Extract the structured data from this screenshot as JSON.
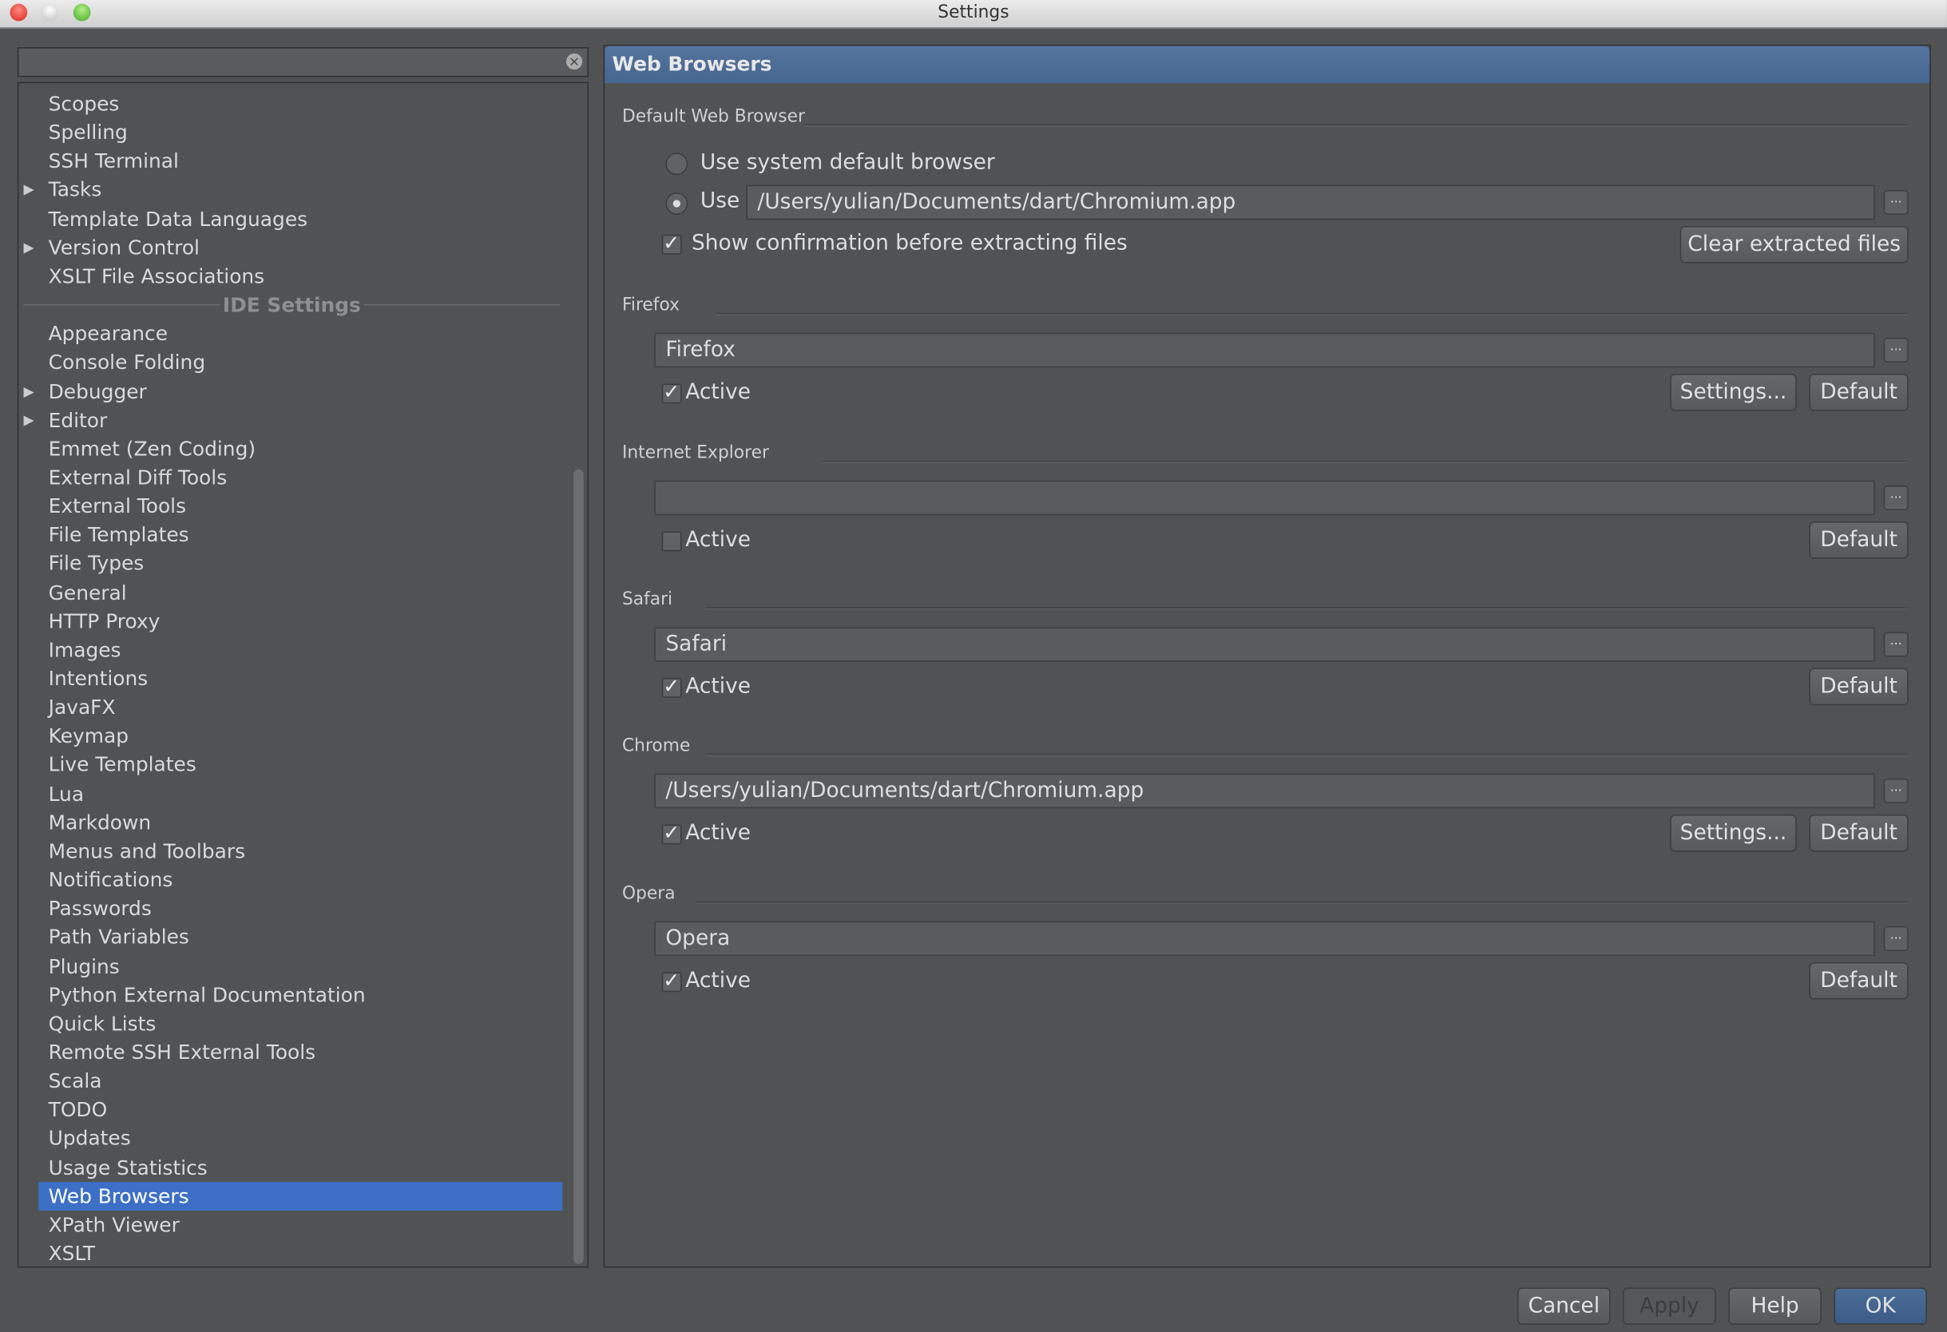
{
  "window": {
    "title": "Settings"
  },
  "search": {
    "value": ""
  },
  "tree": {
    "items": [
      {
        "label": "Scopes"
      },
      {
        "label": "Spelling"
      },
      {
        "label": "SSH Terminal"
      },
      {
        "label": "Tasks",
        "expandable": true
      },
      {
        "label": "Template Data Languages"
      },
      {
        "label": "Version Control",
        "expandable": true
      },
      {
        "label": "XSLT File Associations"
      },
      {
        "label": "IDE Settings",
        "header": true
      },
      {
        "label": "Appearance"
      },
      {
        "label": "Console Folding"
      },
      {
        "label": "Debugger",
        "expandable": true
      },
      {
        "label": "Editor",
        "expandable": true
      },
      {
        "label": "Emmet (Zen Coding)"
      },
      {
        "label": "External Diff Tools"
      },
      {
        "label": "External Tools"
      },
      {
        "label": "File Templates"
      },
      {
        "label": "File Types"
      },
      {
        "label": "General"
      },
      {
        "label": "HTTP Proxy"
      },
      {
        "label": "Images"
      },
      {
        "label": "Intentions"
      },
      {
        "label": "JavaFX"
      },
      {
        "label": "Keymap"
      },
      {
        "label": "Live Templates"
      },
      {
        "label": "Lua"
      },
      {
        "label": "Markdown"
      },
      {
        "label": "Menus and Toolbars"
      },
      {
        "label": "Notifications"
      },
      {
        "label": "Passwords"
      },
      {
        "label": "Path Variables"
      },
      {
        "label": "Plugins"
      },
      {
        "label": "Python External Documentation"
      },
      {
        "label": "Quick Lists"
      },
      {
        "label": "Remote SSH External Tools"
      },
      {
        "label": "Scala"
      },
      {
        "label": "TODO"
      },
      {
        "label": "Updates"
      },
      {
        "label": "Usage Statistics"
      },
      {
        "label": "Web Browsers",
        "selected": true
      },
      {
        "label": "XPath Viewer"
      },
      {
        "label": "XSLT"
      }
    ]
  },
  "panel": {
    "title": "Web Browsers",
    "default_browser": {
      "group": "Default Web Browser",
      "system_label": "Use system default browser",
      "use_label": "Use",
      "path": "/Users/yulian/Documents/dart/Chromium.app",
      "confirm_label": "Show confirmation before extracting files",
      "confirm_checked": true,
      "clear_label": "Clear extracted files",
      "selected": "use"
    },
    "browsers": [
      {
        "group": "Firefox",
        "path": "Firefox",
        "active": true,
        "has_settings": true
      },
      {
        "group": "Internet Explorer",
        "path": "",
        "active": false,
        "has_settings": false
      },
      {
        "group": "Safari",
        "path": "Safari",
        "active": true,
        "has_settings": false
      },
      {
        "group": "Chrome",
        "path": "/Users/yulian/Documents/dart/Chromium.app",
        "active": true,
        "has_settings": true
      },
      {
        "group": "Opera",
        "path": "Opera",
        "active": true,
        "has_settings": false
      }
    ],
    "active_label": "Active",
    "settings_label": "Settings...",
    "default_label": "Default",
    "browse_label": "..."
  },
  "footer": {
    "cancel": "Cancel",
    "apply": "Apply",
    "help": "Help",
    "ok": "OK"
  }
}
